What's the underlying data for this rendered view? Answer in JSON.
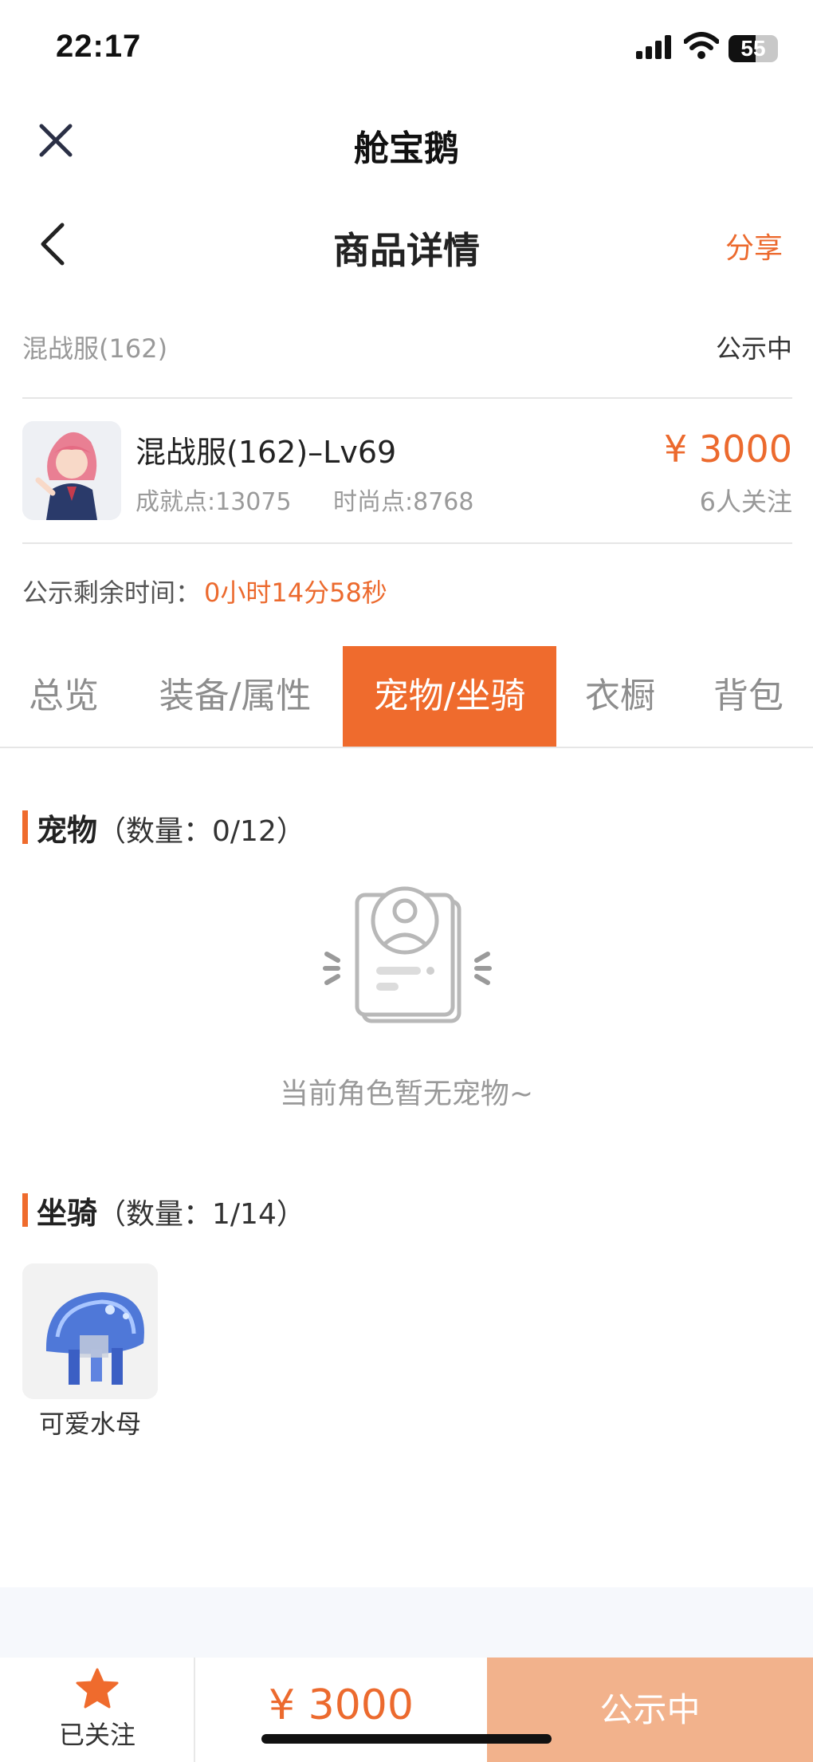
{
  "status_bar": {
    "time": "22:17",
    "battery": "55",
    "battery_level": 0.55
  },
  "app": {
    "title": "舱宝鹅"
  },
  "header": {
    "title": "商品详情",
    "share_label": "分享"
  },
  "server": {
    "name": "混战服(162)",
    "status": "公示中"
  },
  "product": {
    "title": "混战服(162)–Lv69",
    "achievement": "成就点:13075",
    "fashion": "时尚点:8768",
    "price": "¥ 3000",
    "followers": "6人关注"
  },
  "countdown": {
    "label": "公示剩余时间：",
    "value": "0小时14分58秒"
  },
  "tabs": [
    {
      "label": "总览",
      "active": false
    },
    {
      "label": "装备/属性",
      "active": false
    },
    {
      "label": "宠物/坐骑",
      "active": true
    },
    {
      "label": "衣橱",
      "active": false
    },
    {
      "label": "背包",
      "active": false
    }
  ],
  "pets": {
    "title": "宠物",
    "count": "（数量：0/12）",
    "empty_text": "当前角色暂无宠物~"
  },
  "mounts": {
    "title": "坐骑",
    "count": "（数量：1/14）",
    "items": [
      {
        "name": "可爱水母",
        "icon": "jellyfish-mount-image"
      }
    ]
  },
  "bottom_bar": {
    "follow_label": "已关注",
    "price": "¥ 3000",
    "status_button": "公示中"
  },
  "colors": {
    "accent": "#ef6b2d",
    "accent_light": "#f2b28c",
    "text_muted": "#999999"
  }
}
